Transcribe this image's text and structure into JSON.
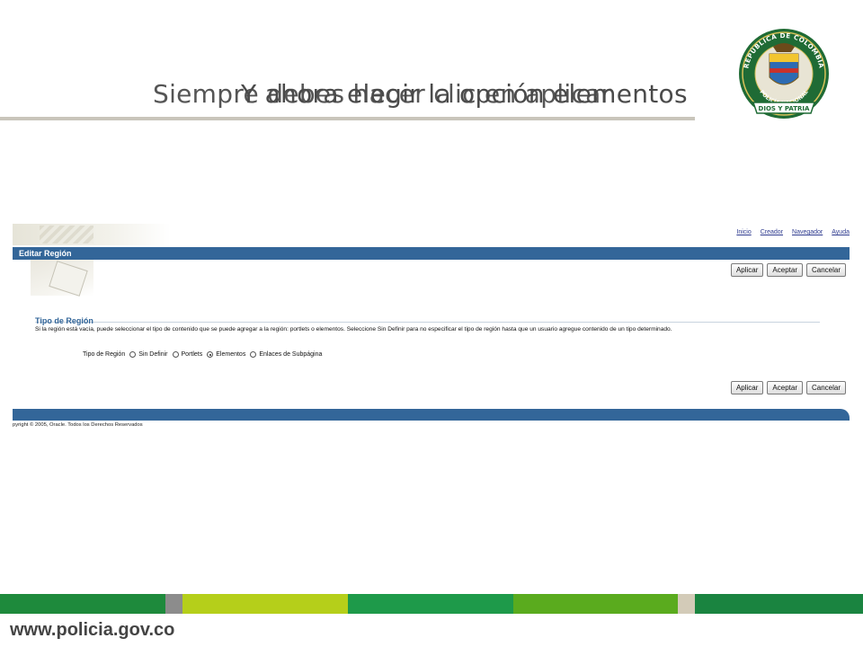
{
  "slide": {
    "title_line_1": "Siempre debes hacer clic en aplicar",
    "title_line_2": "Y ahora elegir la opción elementos",
    "website": "www.policia.gov.co",
    "crest_text": {
      "outer": "REPÚBLICA DE COLOMBIA",
      "inner": "POLICÍA NACIONAL",
      "ribbon": "DIOS Y PATRIA"
    },
    "colors": {
      "rule": "#c9c5bb",
      "bar": [
        "#1e8a3c",
        "#8c8c8c",
        "#b5cf1a",
        "#1e9a4a",
        "#5aab1e",
        "#d3cbb8",
        "#1a8440"
      ]
    }
  },
  "app": {
    "global_links": [
      "Inicio",
      "Creador",
      "Navegador",
      "Ayuda"
    ],
    "page_title": "Editar Región",
    "buttons": {
      "apply": "Aplicar",
      "accept": "Aceptar",
      "cancel": "Cancelar"
    },
    "section_title": "Tipo de Región",
    "description": "Si la región está vacía, puede seleccionar el tipo de contenido que se puede agregar a la región: portlets o elementos. Seleccione Sin Definir para no especificar el tipo de región hasta que un usuario agregue contenido de un tipo determinado.",
    "region_type": {
      "label": "Tipo de Región",
      "options": [
        "Sin Definir",
        "Portlets",
        "Elementos",
        "Enlaces de Subpágina"
      ],
      "selected": "Elementos"
    },
    "copyright": "pyright © 2005, Oracle. Todos los Derechos Reservados",
    "colors": {
      "primary": "#336699",
      "link": "#2f3b8f"
    }
  }
}
